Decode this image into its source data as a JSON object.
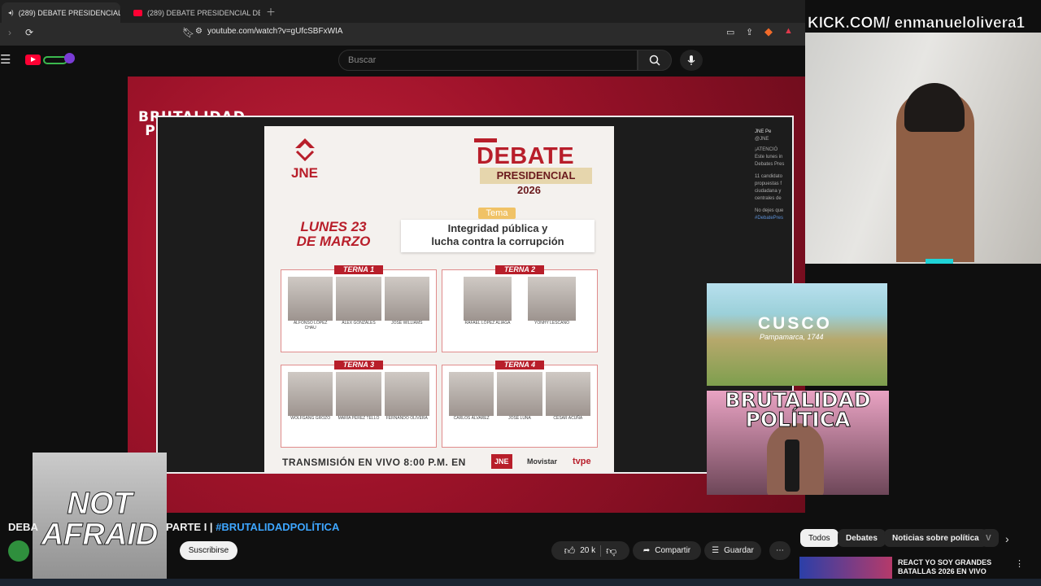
{
  "browser": {
    "tabs": [
      {
        "label": "(289) DEBATE PRESIDENCIAL"
      },
      {
        "label": "(289) DEBATE PRESIDENCIAL DEL JN"
      }
    ],
    "url": "youtube.com/watch?v=gUfcSBFxWIA"
  },
  "youtube": {
    "search_placeholder": "Buscar"
  },
  "overlay": {
    "kick": "KICK.COM/ enmanueloliverа1",
    "brut_logo": "BRUTALIDAD POLÍTICA",
    "cusco_title": "CUSCO",
    "cusco_sub": "Pampamarca, 1744",
    "streamer_text": "BRUTALIDAD POLÍTICA",
    "not_afraid": "NOT AFRAID"
  },
  "poster": {
    "jne": "JNE",
    "debate_word": "DEBATE",
    "presidencial": "PRESIDENCIAL",
    "year": "2026",
    "fecha_1": "LUNES 23",
    "fecha_2": "DE MARZO",
    "tema_tag": "Tema",
    "tema_1": "Integridad pública y",
    "tema_2": "lucha contra la corrupción",
    "ternas": [
      {
        "title": "TERNA 1",
        "cands": [
          "ALFONSO LÓPEZ CHAU",
          "ÁLEX GONZALES",
          "JOSÉ WILLIAMS"
        ]
      },
      {
        "title": "TERNA 2",
        "cands": [
          "RAFAEL LÓPEZ ALIAGA",
          "YONHY LESCANO"
        ]
      },
      {
        "title": "TERNA 3",
        "cands": [
          "WOLFGANG GROZO",
          "MARÍA PÉREZ TELLO",
          "FERNANDO OLIVERA"
        ]
      },
      {
        "title": "TERNA 4",
        "cands": [
          "CARLOS ÁLVAREZ",
          "JOSÉ LUNA",
          "CÉSAR ACUÑA"
        ]
      }
    ],
    "transmision": "TRANSMISIÓN EN VIVO 8:00 P.M. EN",
    "footer_jne": "JNE",
    "footer_movistar": "Movistar",
    "footer_tvpe": "tvpe"
  },
  "tweet": {
    "lines": [
      "JNE Pe",
      "@JNE",
      "¡ATENCIÓ",
      "Este lunes in",
      "Debates Pres",
      "11 candidato",
      "propuestas f",
      "ciudadana y",
      "centrales de",
      "No dejes que",
      "#DebatePres"
    ]
  },
  "video_info": {
    "title_left": "DEBA",
    "title_right_plain": "PARTE I | ",
    "title_right_hash": "#BRUTALIDADPOLÍTICA",
    "subscribe": "Suscribirse",
    "likes": "20 k",
    "share": "Compartir",
    "save": "Guardar"
  },
  "chips": [
    "Todos",
    "Debates",
    "Noticias sobre política",
    "V"
  ],
  "recommendation": {
    "title": "REACT YO SOY GRANDES BATALLAS 2026 EN VIVO"
  },
  "colors": {
    "accent_red": "#b81e2a",
    "yt_red": "#ff0033",
    "link_blue": "#3ea6ff"
  }
}
